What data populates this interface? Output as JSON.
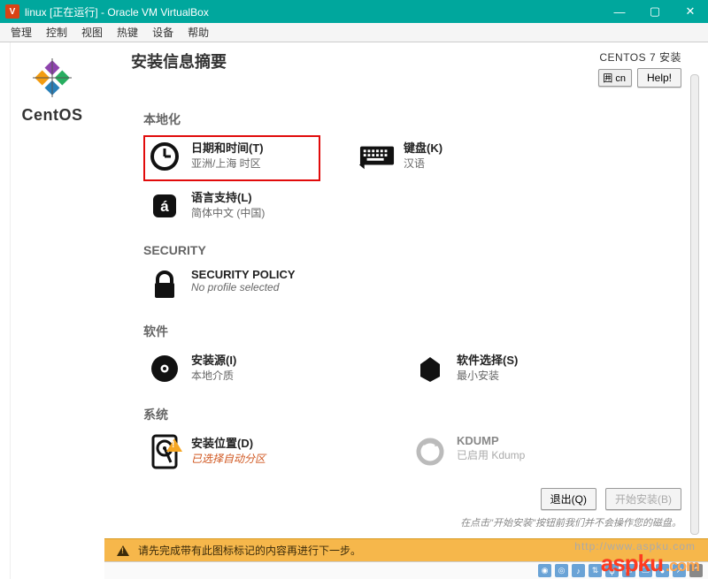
{
  "vb": {
    "title": "linux [正在运行] - Oracle VM VirtualBox",
    "menu": [
      "管理",
      "控制",
      "视图",
      "热键",
      "设备",
      "帮助"
    ],
    "winbtns": {
      "min": "—",
      "max": "▢",
      "close": "✕"
    }
  },
  "sidebar": {
    "brand": "CentOS"
  },
  "header": {
    "title": "安装信息摘要",
    "distro": "CENTOS 7 安装",
    "lang_badge": "囲 cn",
    "help": "Help!"
  },
  "sections": {
    "local": "本地化",
    "security": "SECURITY",
    "software": "软件",
    "system": "系统"
  },
  "items": {
    "datetime": {
      "title": "日期和时间(T)",
      "sub": "亚洲/上海 时区"
    },
    "keyboard": {
      "title": "键盘(K)",
      "sub": "汉语"
    },
    "language": {
      "title": "语言支持(L)",
      "sub": "简体中文 (中国)"
    },
    "secpolicy": {
      "title": "SECURITY POLICY",
      "sub": "No profile selected"
    },
    "source": {
      "title": "安装源(I)",
      "sub": "本地介质"
    },
    "swselect": {
      "title": "软件选择(S)",
      "sub": "最小安装"
    },
    "dest": {
      "title": "安装位置(D)",
      "sub": "已选择自动分区"
    },
    "kdump": {
      "title": "KDUMP",
      "sub": "已启用 Kdump"
    }
  },
  "bottom": {
    "quit": "退出(Q)",
    "begin": "开始安装(B)",
    "hint": "在点击\"开始安装\"按钮前我们并不会操作您的磁盘。"
  },
  "banner": "请先完成带有此图标标记的内容再进行下一步。",
  "watermark": {
    "main": "aspku",
    "suffix": ".com",
    "sub": "http://www.aspku.com"
  }
}
